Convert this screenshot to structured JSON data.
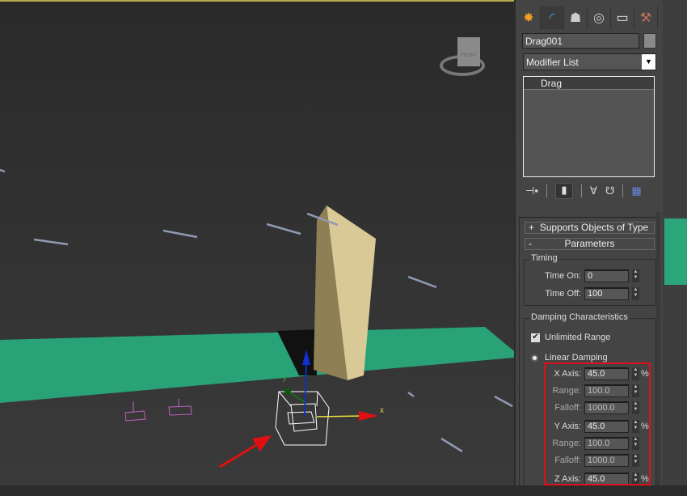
{
  "viewport": {
    "viewcube_label": "FRONT",
    "gizmo_x_label": "x",
    "gizmo_y_label": "y",
    "colors": {
      "ground_plane": "#2da57a",
      "box": "#c9b98a",
      "selection_box": "#ffffff",
      "annotation_arrow": "#e01010"
    }
  },
  "command_panel": {
    "tabs": [
      {
        "icon": "create-icon"
      },
      {
        "icon": "modify-icon",
        "active": true
      },
      {
        "icon": "hierarchy-icon"
      },
      {
        "icon": "motion-icon"
      },
      {
        "icon": "display-icon"
      },
      {
        "icon": "utilities-icon"
      }
    ],
    "object_name": "Drag001",
    "modifier_list": "Modifier List",
    "stack_items": [
      "Drag"
    ]
  },
  "rollouts": {
    "supports": {
      "sign": "+",
      "title": "Supports Objects of Type"
    },
    "parameters": {
      "sign": "-",
      "title": "Parameters"
    },
    "timing": {
      "title": "Timing",
      "time_on_label": "Time On:",
      "time_on": "0",
      "time_off_label": "Time Off:",
      "time_off": "100"
    },
    "damping": {
      "title": "Damping Characteristics",
      "unlimited_range_label": "Unlimited Range",
      "unlimited_range_checked": true,
      "linear_damping_label": "Linear Damping",
      "linear_damping_selected": true,
      "x_axis_label": "X Axis:",
      "x_axis": "45.0",
      "x_range_label": "Range:",
      "x_range": "100.0",
      "x_falloff_label": "Falloff:",
      "x_falloff": "1000.0",
      "y_axis_label": "Y Axis:",
      "y_axis": "45.0",
      "y_range_label": "Range:",
      "y_range": "100.0",
      "y_falloff_label": "Falloff:",
      "y_falloff": "1000.0",
      "z_axis_label": "Z Axis:",
      "z_axis": "45.0",
      "unit": "%"
    }
  }
}
